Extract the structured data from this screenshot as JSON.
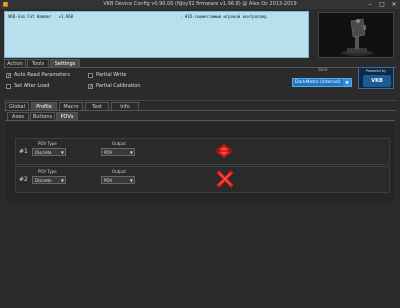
{
  "window": {
    "title": "VKB Device Config v0.90.00 (NJoy32 firmware v1.96.8) @ Alex Oz 2013-2019",
    "minimize_glyph": "–",
    "maximize_glyph": "□",
    "close_glyph": "✕"
  },
  "device_info": {
    "line": "VKB-Sim Fat Hammer   v1.96B",
    "description": ": HID-совместимый игровой контроллер"
  },
  "top_tabs": [
    {
      "label": "Action"
    },
    {
      "label": "Tools"
    },
    {
      "label": "Settings"
    }
  ],
  "settings": {
    "auto_read_params": {
      "label": "Auto Read Parameters",
      "checked": true
    },
    "set_after_load": {
      "label": "Set After Load",
      "checked": false
    },
    "partial_write": {
      "label": "Partial Write",
      "checked": false
    },
    "partial_calibration": {
      "label": "Partial Calibration",
      "checked": true
    },
    "check_glyph": "✓"
  },
  "skin": {
    "label": "Skin",
    "value": "DarkMetro (internal)",
    "arrow": "▼"
  },
  "powered_by": {
    "label": "Powered by",
    "logo": "VKB"
  },
  "main_tabs": [
    {
      "label": "Global"
    },
    {
      "label": "Profile"
    },
    {
      "label": "Macro"
    },
    {
      "label": "Test"
    },
    {
      "label": "Info"
    }
  ],
  "sub_tabs": [
    {
      "label": "Axes"
    },
    {
      "label": "Buttons"
    },
    {
      "label": "POVs"
    }
  ],
  "povs": [
    {
      "num": "#1",
      "type_label": "POV Type",
      "type_value": "Discrete",
      "output_label": "Output",
      "output_value": "POV",
      "status_icon": "pov-active",
      "icon_color": "#d21e1e"
    },
    {
      "num": "#2",
      "type_label": "POV Type",
      "type_value": "Discrete",
      "output_label": "Output",
      "output_value": "POV",
      "status_icon": "pov-disabled",
      "icon_color": "#d21e1e"
    }
  ],
  "dropdown_arrow": "▼"
}
